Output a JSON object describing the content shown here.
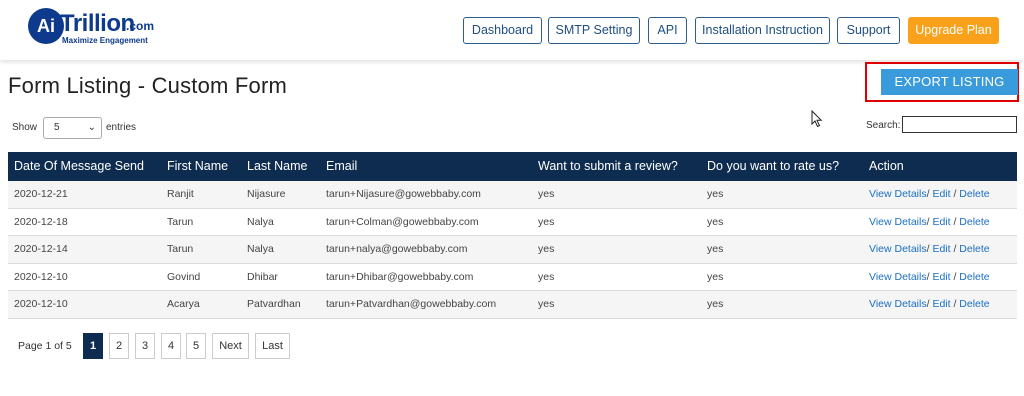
{
  "brand": {
    "logo_ai": "Ai",
    "logo_word": "Trillion",
    "logo_com": ".com",
    "tagline": "Maximize Engagement",
    "color": "#0d3a8c"
  },
  "nav": {
    "dashboard": "Dashboard",
    "smtp": "SMTP Setting",
    "api": "API",
    "install": "Installation Instruction",
    "support": "Support",
    "upgrade": "Upgrade Plan",
    "upgrade_color": "#f9a11b"
  },
  "page": {
    "title": "Form Listing - Custom Form",
    "export_label": "EXPORT LISTING",
    "export_color": "#3a9bdc"
  },
  "controls": {
    "show_label": "Show",
    "entries_value": "5",
    "entries_label": "entries",
    "search_label": "Search:",
    "search_value": ""
  },
  "table": {
    "header_color": "#0d2c4f",
    "columns": [
      "Date Of Message Send",
      "First Name",
      "Last Name",
      "Email",
      "Want to submit a review?",
      "Do you want to rate us?",
      "Action"
    ],
    "rows": [
      {
        "date": "2020-12-21",
        "first": "Ranjit",
        "last": "Nijasure",
        "email": "tarun+Nijasure@gowebbaby.com",
        "review": "yes",
        "rate": "yes"
      },
      {
        "date": "2020-12-18",
        "first": "Tarun",
        "last": "Nalya",
        "email": "tarun+Colman@gowebbaby.com",
        "review": "yes",
        "rate": "yes"
      },
      {
        "date": "2020-12-14",
        "first": "Tarun",
        "last": "Nalya",
        "email": "tarun+nalya@gowebbaby.com",
        "review": "yes",
        "rate": "yes"
      },
      {
        "date": "2020-12-10",
        "first": "Govind",
        "last": "Dhibar",
        "email": "tarun+Dhibar@gowebbaby.com",
        "review": "yes",
        "rate": "yes"
      },
      {
        "date": "2020-12-10",
        "first": "Acarya",
        "last": "Patvardhan",
        "email": "tarun+Patvardhan@gowebbaby.com",
        "review": "yes",
        "rate": "yes"
      }
    ],
    "actions": {
      "view": "View Details",
      "edit": "Edit",
      "delete": "Delete",
      "sep1": "/",
      "sep2": "/"
    }
  },
  "pagination": {
    "info": "Page 1 of 5",
    "pages": [
      "1",
      "2",
      "3",
      "4",
      "5"
    ],
    "current": "1",
    "next": "Next",
    "last": "Last"
  },
  "icons": {
    "cursor": "mouse-pointer-icon",
    "dropdown": "chevron-down-icon"
  }
}
